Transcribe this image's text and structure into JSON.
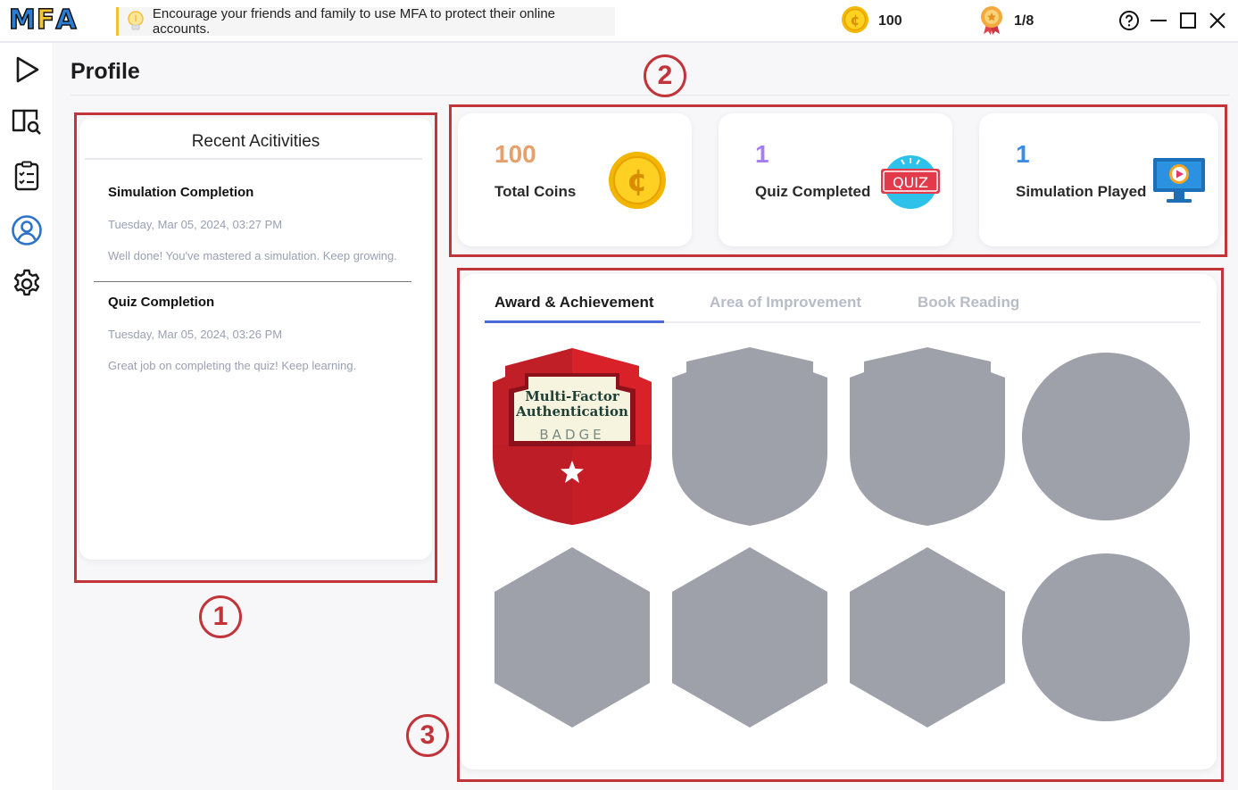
{
  "app": {
    "logo_letters": [
      "M",
      "F",
      "A"
    ],
    "tip": "Encourage your friends and family to use MFA to protect their online accounts.",
    "coins": "100",
    "progress": "1/8"
  },
  "colors": {
    "accent": "#4a68d9",
    "coin_orange": "#e8a06a",
    "quiz_purple": "#a57ff0",
    "sim_blue": "#3a8de3",
    "annotation_red": "#c0343a",
    "locked_badge": "#9fa1aa",
    "logo_blue": "#2a7fd4",
    "logo_yellow": "#f4c531"
  },
  "sidebar": {
    "items": [
      {
        "name": "play",
        "icon": "play-icon"
      },
      {
        "name": "guide",
        "icon": "book-search-icon"
      },
      {
        "name": "quiz",
        "icon": "checklist-icon"
      },
      {
        "name": "profile",
        "icon": "profile-icon",
        "active": true
      },
      {
        "name": "settings",
        "icon": "gear-icon"
      }
    ]
  },
  "page": {
    "title": "Profile"
  },
  "annotations": [
    "1",
    "2",
    "3"
  ],
  "activities": {
    "heading": "Recent Acitivities",
    "items": [
      {
        "title": "Simulation Completion",
        "date": "Tuesday, Mar 05, 2024, 03:27 PM",
        "message": "Well done! You've mastered a simulation. Keep growing."
      },
      {
        "title": "Quiz Completion",
        "date": "Tuesday, Mar 05, 2024, 03:26 PM",
        "message": "Great job on completing the quiz! Keep learning."
      }
    ]
  },
  "stats": [
    {
      "value": "100",
      "label": "Total Coins",
      "icon": "coin-icon"
    },
    {
      "value": "1",
      "label": "Quiz Completed",
      "icon": "quiz-icon"
    },
    {
      "value": "1",
      "label": "Simulation Played",
      "icon": "simulation-icon"
    }
  ],
  "achievements": {
    "tabs": [
      "Award & Achievement",
      "Area of Improvement",
      "Book Reading"
    ],
    "active_tab": "Award & Achievement",
    "earned_badge": {
      "line1": "Multi-Factor",
      "line2": "Authentication",
      "line3": "BADGE"
    },
    "badges": [
      {
        "shape": "shield",
        "earned": true
      },
      {
        "shape": "shield",
        "earned": false
      },
      {
        "shape": "shield",
        "earned": false
      },
      {
        "shape": "circle",
        "earned": false
      },
      {
        "shape": "hexagon",
        "earned": false
      },
      {
        "shape": "hexagon",
        "earned": false
      },
      {
        "shape": "hexagon",
        "earned": false
      },
      {
        "shape": "circle",
        "earned": false
      }
    ]
  },
  "quiz_icon_text": "QUIZ"
}
